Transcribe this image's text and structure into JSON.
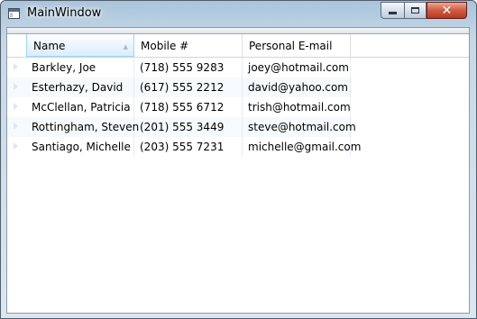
{
  "window": {
    "title": "MainWindow"
  },
  "caption_buttons": {
    "minimize": "minimize-icon",
    "maximize": "maximize-icon",
    "close": "close-icon"
  },
  "grid": {
    "columns": [
      {
        "key": "name",
        "label": "Name",
        "sorted": true
      },
      {
        "key": "mobile",
        "label": "Mobile #",
        "sorted": false
      },
      {
        "key": "email",
        "label": "Personal E-mail",
        "sorted": false
      }
    ],
    "rows": [
      {
        "name": "Barkley, Joe",
        "mobile": "(718) 555 9283",
        "email": "joey@hotmail.com"
      },
      {
        "name": "Esterhazy, David",
        "mobile": "(617) 555 2212",
        "email": "david@yahoo.com"
      },
      {
        "name": "McClellan, Patricia",
        "mobile": "(718) 555 6712",
        "email": "trish@hotmail.com"
      },
      {
        "name": "Rottingham, Steven",
        "mobile": "(201) 555 3449",
        "email": "steve@hotmail.com"
      },
      {
        "name": "Santiago, Michelle",
        "mobile": "(203) 555 7231",
        "email": "michelle@gmail.com"
      }
    ]
  }
}
